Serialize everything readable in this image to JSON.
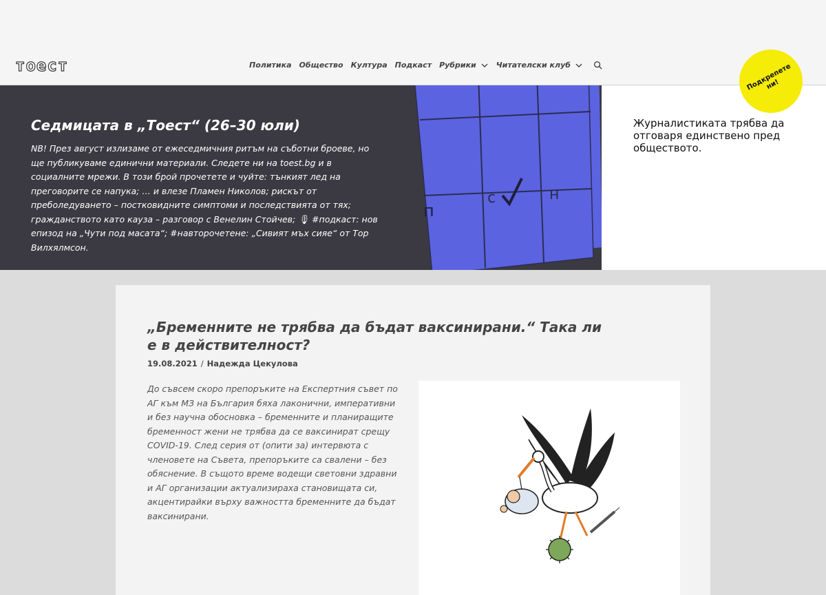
{
  "header": {
    "logo": "тоест",
    "nav": [
      {
        "label": "Политика"
      },
      {
        "label": "Общество"
      },
      {
        "label": "Култура"
      },
      {
        "label": "Подкаст"
      },
      {
        "label": "Рубрики"
      },
      {
        "label": "Читателски клуб"
      }
    ]
  },
  "support": {
    "label": "Подкрепете ни!"
  },
  "banner": {
    "title": "Седмицата в „Тоест“ (26–30 юли)",
    "text": "NB! През август излизаме от ежеседмичния ритъм на съботни броеве, но ще публикуваме единични материали. Следете ни на toest.bg и в социалните мрежи. В този брой прочетете и чуйте: тънкият лед на преговорите се напука; … и влезе Пламен Николов; рискът от преболедуването – постковидните симптоми и последствията от тях; гражданството като кауза – разговор с Венелин Стойчев; 🎙 #подкаст: нов епизод на „Чути под масата“; #навторочетене: „Сивият мъх сияе“ от Тор Вилхялмсон.",
    "calendar_letters": [
      "п",
      "с",
      "н"
    ]
  },
  "slogan": {
    "text": "Журналистиката трябва да отговаря единствено пред обществото."
  },
  "article": {
    "title": "„Бременните не трябва да бъдат ваксинирани.“ Така ли е в действителност?",
    "date": "19.08.2021",
    "separator": "/",
    "author": "Надежда Цекулова",
    "body": "До съвсем скоро препоръките на Експертния съвет по АГ към МЗ на България бяха лаконични, императивни и без научна обосновка – бременните и планиращите бременност жени не трябва да се ваксинират срещу COVID-19. След серия от (опити за) интервюта с членовете на Съвета, препоръките са свалени – без обяснение. В същото време водещи световни здравни и АГ организации актуализираха становищата си, акцентирайки върху важността бременните да бъдат ваксинирани."
  },
  "colors": {
    "banner_bg": "#3b3a42",
    "calendar": "#5b63e0",
    "support_bg": "#f5ec07"
  }
}
